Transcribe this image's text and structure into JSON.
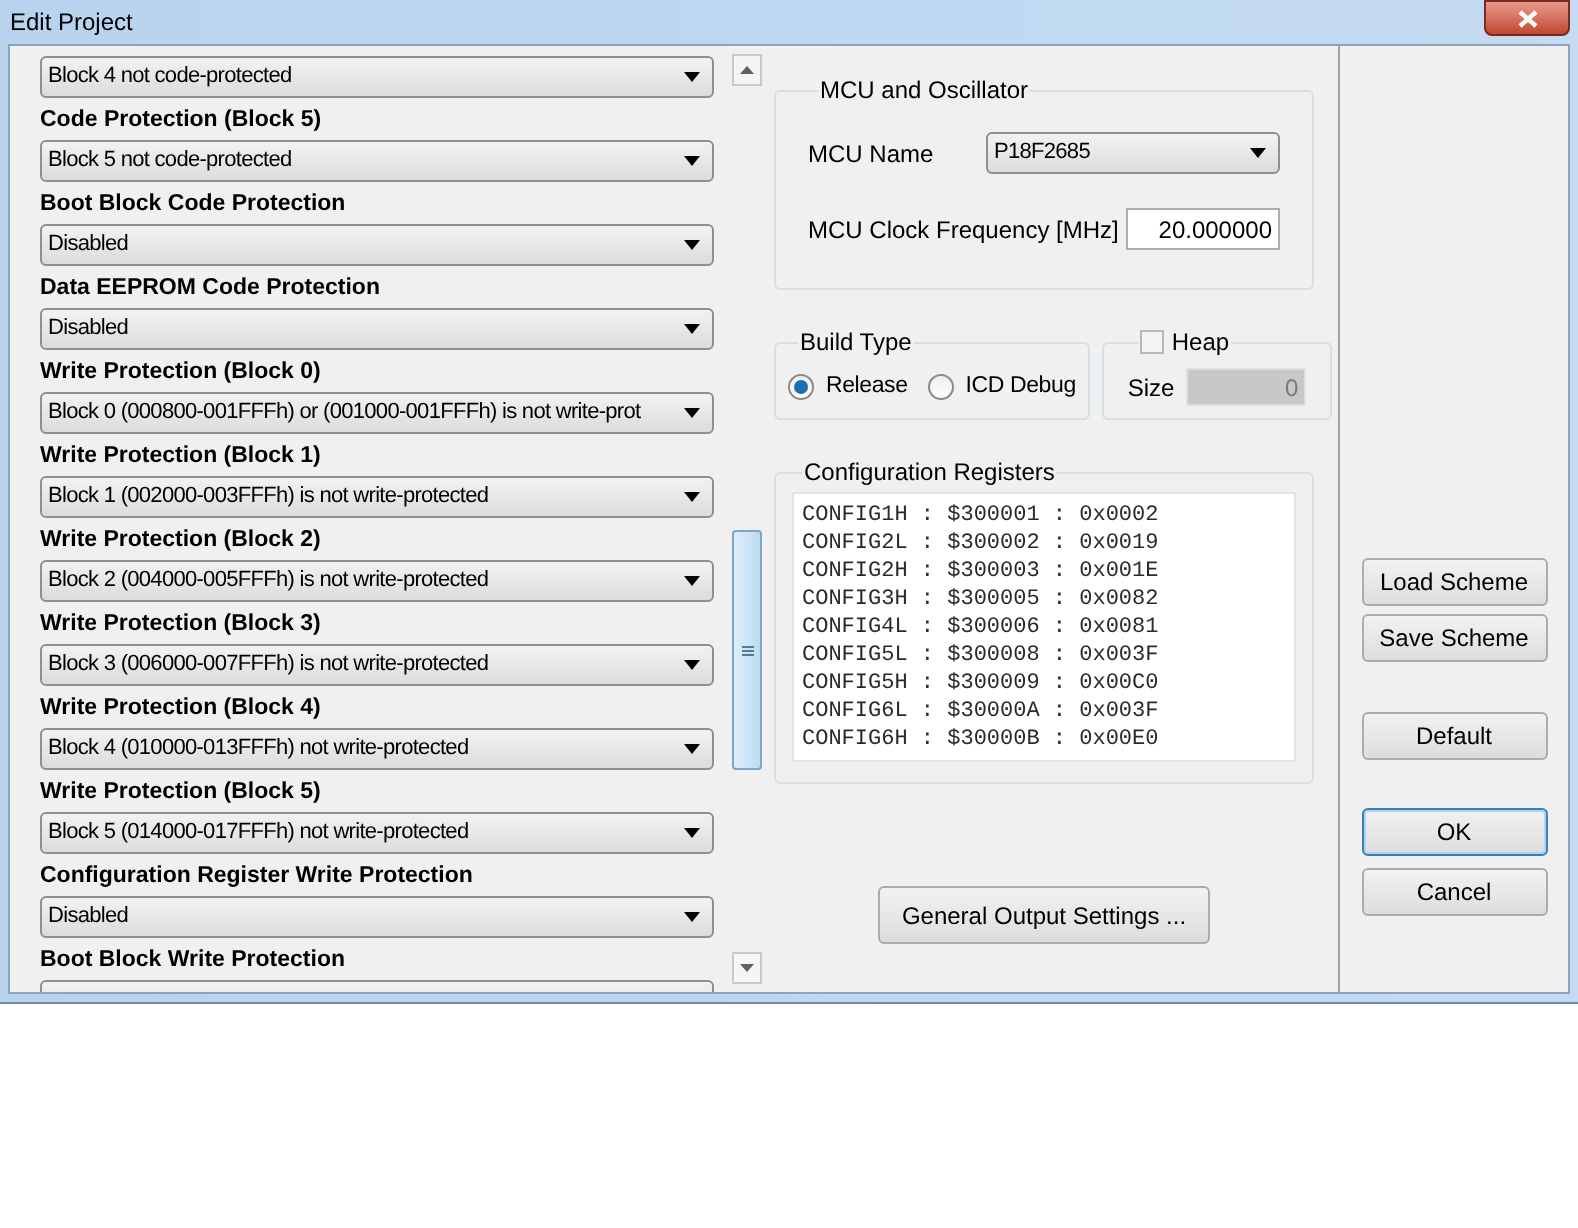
{
  "window": {
    "title": "Edit Project"
  },
  "settings": [
    {
      "value": "Block 4 not code-protected"
    },
    {
      "label": "Code Protection (Block 5)",
      "value": "Block 5 not code-protected"
    },
    {
      "label": "Boot Block Code Protection",
      "value": "Disabled"
    },
    {
      "label": "Data EEPROM Code Protection",
      "value": "Disabled"
    },
    {
      "label": "Write Protection (Block 0)",
      "value": "Block 0 (000800-001FFFh) or (001000-001FFFh) is not write-prot"
    },
    {
      "label": "Write Protection (Block 1)",
      "value": "Block 1 (002000-003FFFh) is not write-protected"
    },
    {
      "label": "Write Protection (Block 2)",
      "value": "Block 2 (004000-005FFFh) is not write-protected"
    },
    {
      "label": "Write Protection (Block 3)",
      "value": "Block 3 (006000-007FFFh) is not write-protected"
    },
    {
      "label": "Write Protection (Block 4)",
      "value": "Block 4 (010000-013FFFh) not write-protected"
    },
    {
      "label": "Write Protection (Block 5)",
      "value": "Block 5 (014000-017FFFh) not write-protected"
    },
    {
      "label": "Configuration Register Write Protection",
      "value": "Disabled"
    },
    {
      "label": "Boot Block Write Protection"
    }
  ],
  "mcu": {
    "title": "MCU and Oscillator",
    "name_label": "MCU Name",
    "name_value": "P18F2685",
    "clock_label": "MCU Clock Frequency [MHz]",
    "clock_value": "20.000000"
  },
  "build_type": {
    "title": "Build Type",
    "options": [
      {
        "label": "Release",
        "selected": true
      },
      {
        "label": "ICD Debug",
        "selected": false
      }
    ]
  },
  "heap": {
    "label": "Heap",
    "checked": false,
    "size_label": "Size",
    "size_value": "0",
    "disabled": true
  },
  "config_registers": {
    "title": "Configuration Registers",
    "lines": [
      "CONFIG1H : $300001 : 0x0002",
      "CONFIG2L : $300002 : 0x0019",
      "CONFIG2H : $300003 : 0x001E",
      "CONFIG3H : $300005 : 0x0082",
      "CONFIG4L : $300006 : 0x0081",
      "CONFIG5L : $300008 : 0x003F",
      "CONFIG5H : $300009 : 0x00C0",
      "CONFIG6L : $30000A : 0x003F",
      "CONFIG6H : $30000B : 0x00E0"
    ]
  },
  "general_button": "General Output Settings ...",
  "side_buttons": [
    {
      "label": "Load Scheme",
      "focused": false
    },
    {
      "label": "Save Scheme",
      "focused": false
    },
    {
      "label": "Default",
      "focused": false
    },
    {
      "label": "OK",
      "focused": true
    },
    {
      "label": "Cancel",
      "focused": false
    }
  ]
}
